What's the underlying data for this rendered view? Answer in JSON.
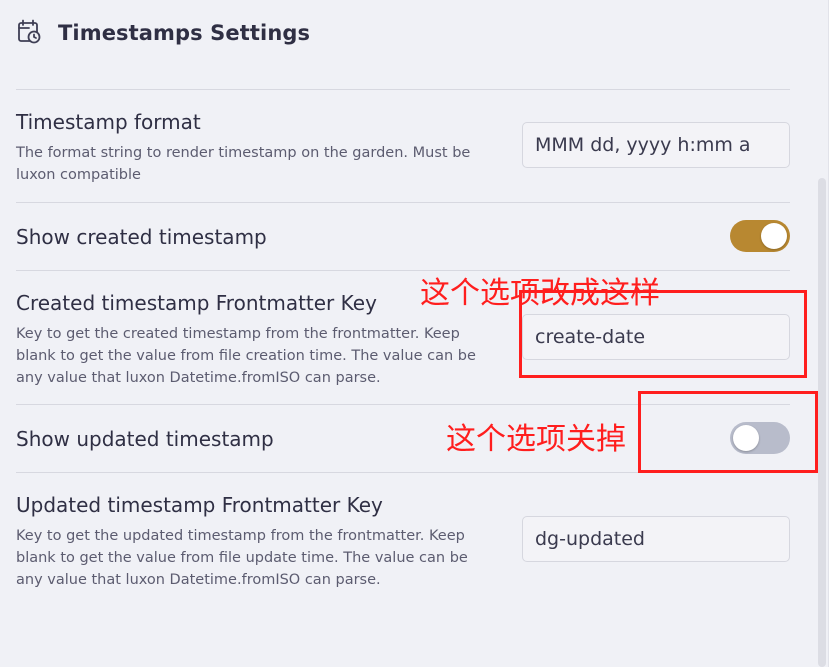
{
  "header": {
    "title": "Timestamps Settings",
    "icon": "calendar-clock-icon"
  },
  "settings": [
    {
      "name": "Timestamp format",
      "description": "The format string to render timestamp on the garden. Must be luxon compatible",
      "value": "MMM dd, yyyy h:mm a"
    },
    {
      "name": "Show created timestamp",
      "enabled": true
    },
    {
      "name": "Created timestamp Frontmatter Key",
      "description": "Key to get the created timestamp from the frontmatter. Keep blank to get the value from file creation time. The value can be any value that luxon Datetime.fromISO can parse.",
      "value": "create-date"
    },
    {
      "name": "Show updated timestamp",
      "enabled": false
    },
    {
      "name": "Updated timestamp Frontmatter Key",
      "description": "Key to get the updated timestamp from the frontmatter. Keep blank to get the value from file update time. The value can be any value that luxon Datetime.fromISO can parse.",
      "value": "dg-updated"
    }
  ],
  "annotations": {
    "change_option": "这个选项改成这样",
    "turn_off_option": "这个选项关掉"
  },
  "colors": {
    "toggle_on": "#b88831",
    "toggle_off": "#b8bccb",
    "annotation": "#ff1e1e",
    "background": "#f0f1f6"
  }
}
